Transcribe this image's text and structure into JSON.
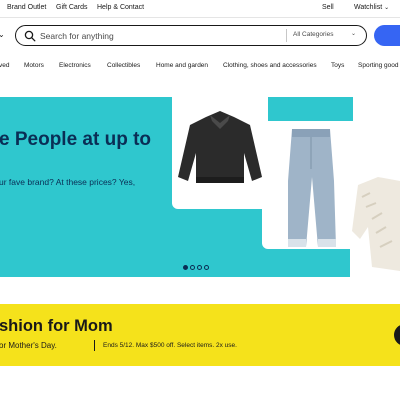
{
  "topbar": {
    "links": [
      "Brand Outlet",
      "Gift Cards",
      "Help & Contact"
    ],
    "sell": "Sell",
    "watchlist": "Watchlist"
  },
  "search": {
    "placeholder": "Search for anything",
    "category": "All Categories"
  },
  "category_nav": [
    "ved",
    "Motors",
    "Electronics",
    "Collectibles",
    "Home and garden",
    "Clothing, shoes and accessories",
    "Toys",
    "Sporting good"
  ],
  "hero": {
    "title": "e People at up to",
    "subtitle": "ur fave brand? At these prices? Yes,",
    "background_color": "#2fc7ce",
    "text_color": "#0a2e55",
    "carousel_dots": 4,
    "active_dot": 0
  },
  "promo": {
    "title": "shion for Mom",
    "subtitle": "or Mother's Day.",
    "fine_print": "Ends 5/12. Max $500 off. Select items. 2x use.",
    "background_color": "#f5e21b"
  },
  "accent_color": "#3665f3"
}
